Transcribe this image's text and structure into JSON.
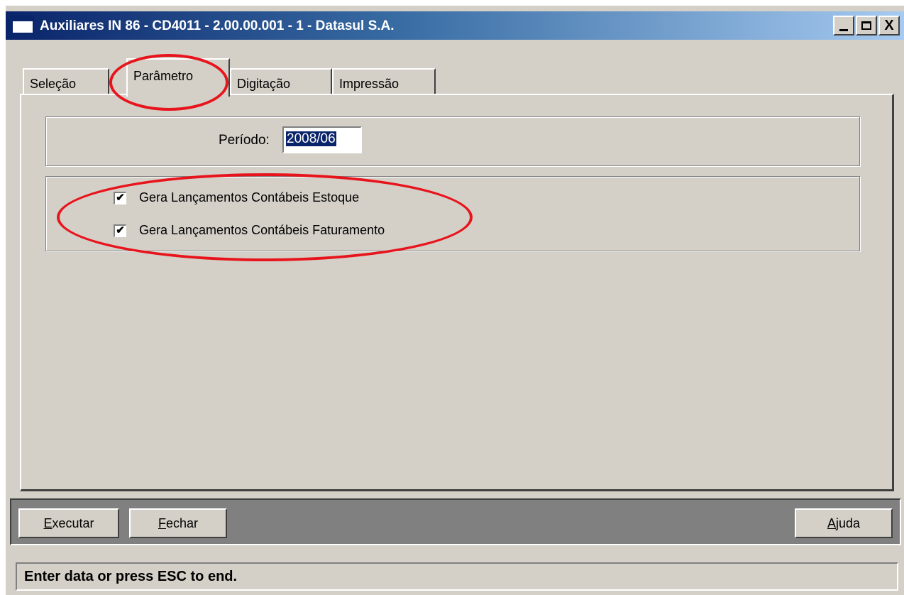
{
  "window": {
    "title": "Auxiliares IN 86 - CD4011 - 2.00.00.001 - 1 - Datasul S.A.",
    "controls": {
      "minimize": "_",
      "maximize": "□",
      "close": "X"
    }
  },
  "tabs": [
    {
      "label": "Seleção",
      "selected": false
    },
    {
      "label": "Parâmetro",
      "selected": true
    },
    {
      "label": "Digitação",
      "selected": false
    },
    {
      "label": "Impressão",
      "selected": false
    }
  ],
  "parametro": {
    "periodo_label": "Período:",
    "periodo_value": "2008/06",
    "checkboxes": [
      {
        "label": "Gera Lançamentos Contábeis Estoque",
        "checked": true,
        "mark": "✔"
      },
      {
        "label": "Gera Lançamentos Contábeis Faturamento",
        "checked": true,
        "mark": "✔"
      }
    ]
  },
  "buttons": {
    "executar": {
      "mnemonic": "E",
      "rest": "xecutar"
    },
    "fechar": {
      "mnemonic": "F",
      "rest": "echar"
    },
    "ajuda": {
      "mnemonic": "A",
      "rest": "juda"
    }
  },
  "status": {
    "message": "Enter data or press ESC to end."
  },
  "colors": {
    "titlebar_start": "#0a246a",
    "titlebar_end": "#a6caf0",
    "face": "#d4d0c8",
    "annotation": "#e8141c",
    "selection": "#0a246a"
  }
}
